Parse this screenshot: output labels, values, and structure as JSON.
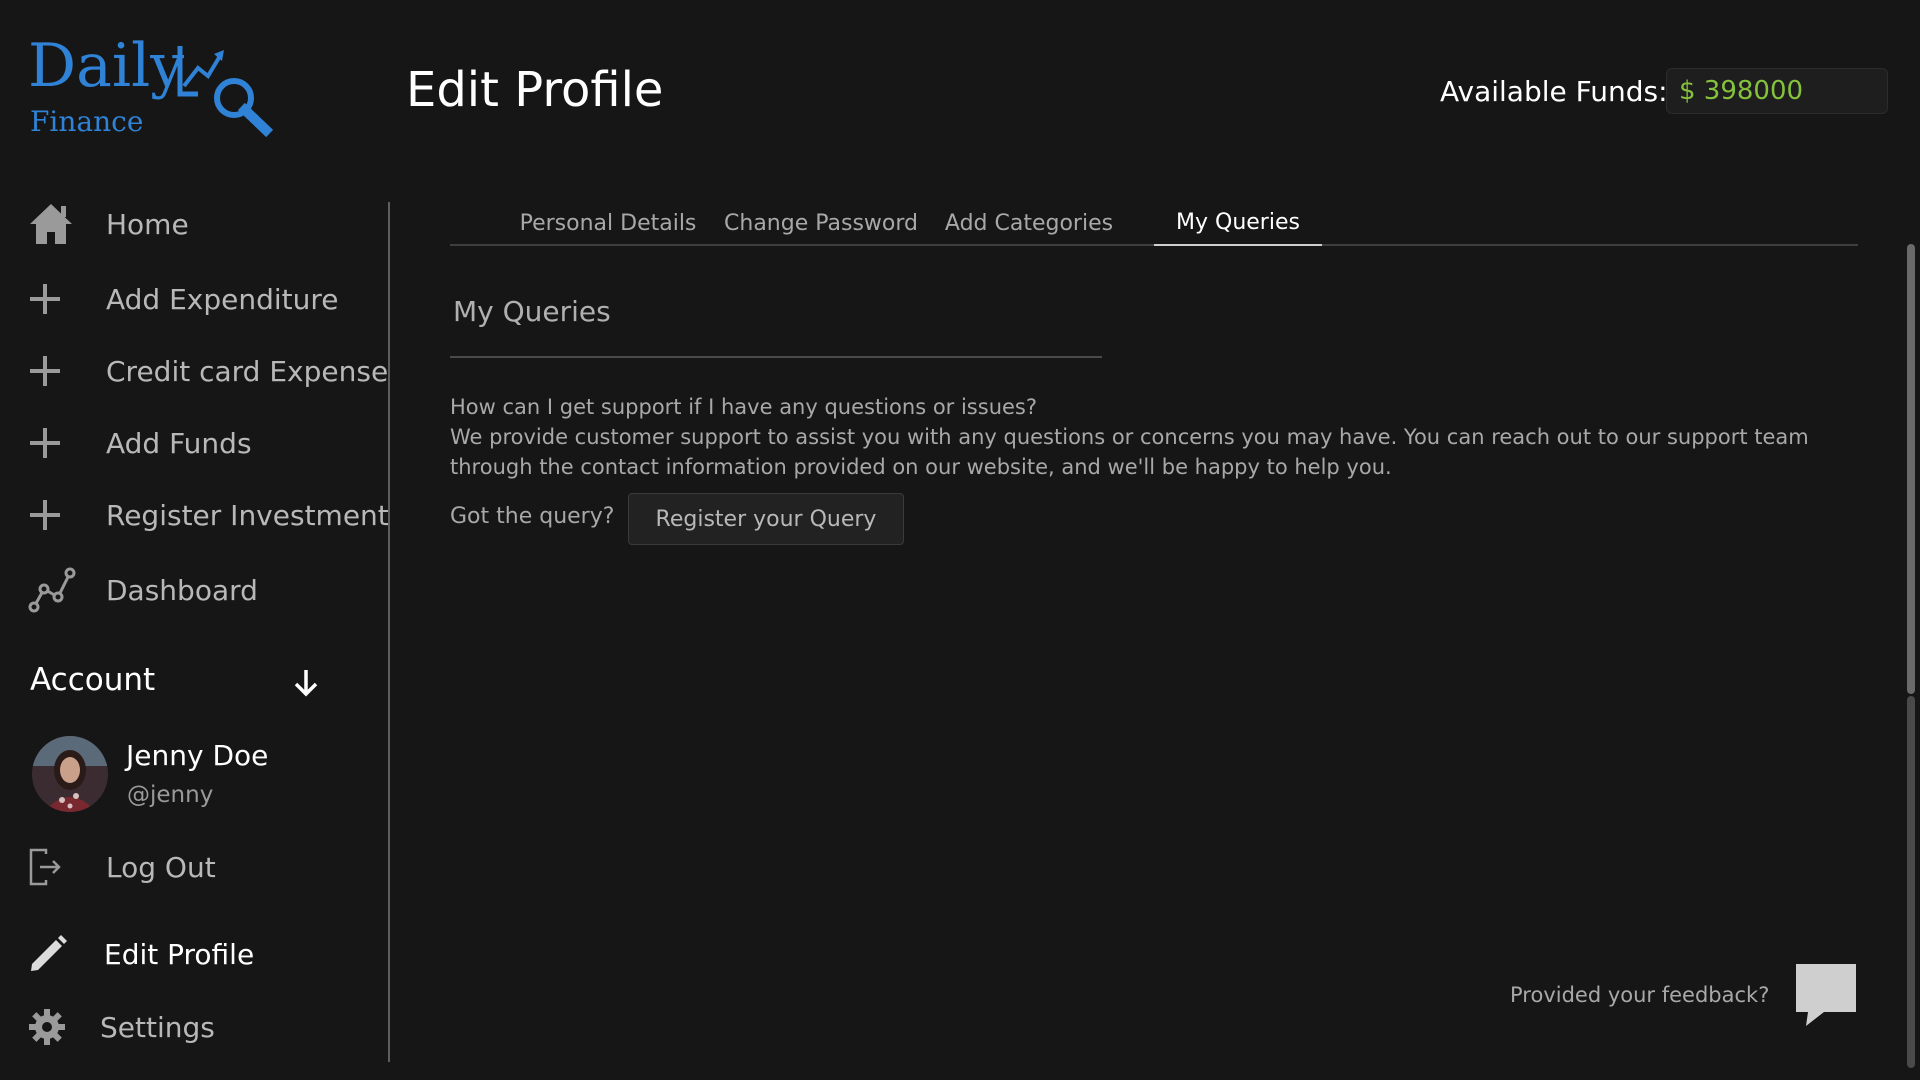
{
  "logo": {
    "line1": "Daily",
    "line2": "Finance"
  },
  "header": {
    "title": "Edit Profile",
    "funds_label": "Available Funds:",
    "funds_value": "$ 398000"
  },
  "sidebar": {
    "items": [
      {
        "label": "Home",
        "icon": "home-icon"
      },
      {
        "label": "Add Expenditure",
        "icon": "plus-icon"
      },
      {
        "label": "Credit card Expense",
        "icon": "plus-icon"
      },
      {
        "label": "Add Funds",
        "icon": "plus-icon"
      },
      {
        "label": "Register Investment",
        "icon": "plus-icon"
      },
      {
        "label": "Dashboard",
        "icon": "line-chart-icon"
      }
    ],
    "account_title": "Account",
    "user": {
      "name": "Jenny Doe",
      "handle": "@jenny"
    },
    "bottom_items": [
      {
        "label": "Log Out",
        "icon": "logout-icon"
      },
      {
        "label": "Edit Profile",
        "icon": "pencil-icon"
      },
      {
        "label": "Settings",
        "icon": "gear-icon"
      }
    ]
  },
  "tabs": [
    {
      "label": "Personal Details"
    },
    {
      "label": "Change Password"
    },
    {
      "label": "Add Categories"
    },
    {
      "label": "My Queries",
      "active": true
    }
  ],
  "main": {
    "section_title": "My Queries",
    "faq_question": "How can I get support if I have any questions or issues?",
    "faq_answer": "We provide customer support to assist you with any questions or concerns you may have. You can reach out to our support team through the contact information provided on our website, and we'll be happy to help you.",
    "query_label": "Got the query?",
    "query_button": "Register your Query",
    "feedback_label": "Provided your feedback?"
  },
  "colors": {
    "background": "#161616",
    "brand_blue": "#2f82d6",
    "funds_green": "#84c13c"
  }
}
